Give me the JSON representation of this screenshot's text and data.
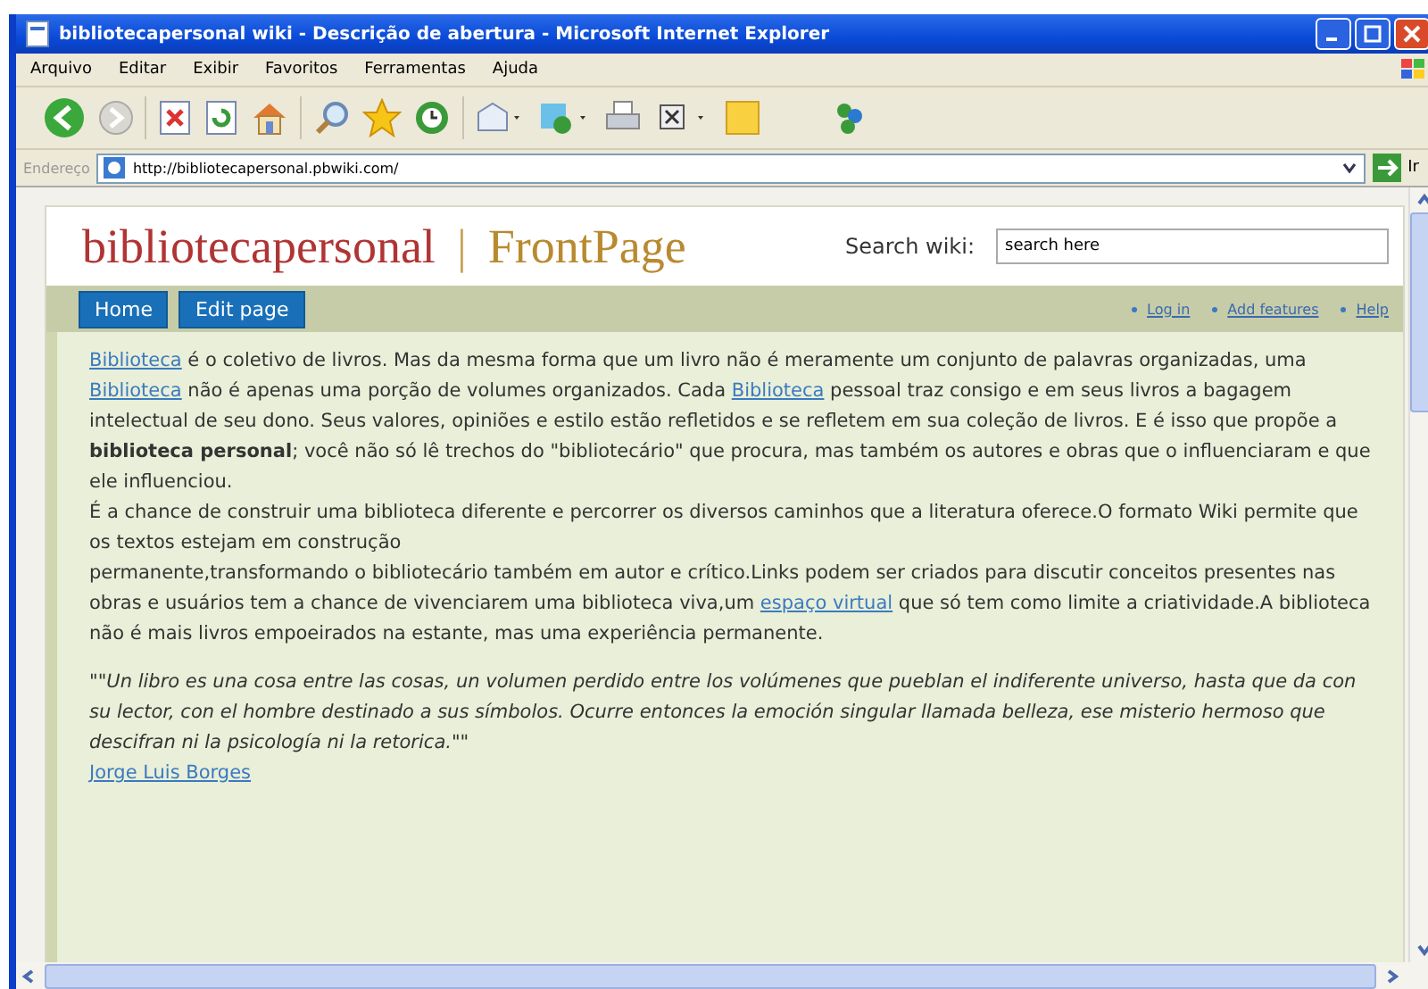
{
  "window": {
    "title": "bibliotecapersonal wiki - Descrição de abertura - Microsoft Internet Explorer"
  },
  "menu": [
    "Arquivo",
    "Editar",
    "Exibir",
    "Favoritos",
    "Ferramentas",
    "Ajuda"
  ],
  "address": {
    "label": "Endereço",
    "url": "http://bibliotecapersonal.pbwiki.com/",
    "go": "Ir"
  },
  "wiki": {
    "site_title": "bibliotecapersonal",
    "separator": "|",
    "page_title": "FrontPage",
    "search": {
      "label": "Search wiki:",
      "value": "search here"
    },
    "nav_buttons": [
      "Home",
      "Edit page"
    ],
    "nav_links": [
      "Log in",
      "Add features",
      "Help"
    ]
  },
  "paragraphs": [
    {
      "parts": [
        {
          "kind": "link",
          "text": "Biblioteca"
        },
        {
          "kind": "text",
          "text": " é o coletivo de livros. Mas da mesma forma que um livro não é meramente um conjunto de palavras organizadas, uma "
        },
        {
          "kind": "link",
          "text": "Biblioteca"
        },
        {
          "kind": "text",
          "text": " não é apenas uma porção de volumes organizados. Cada "
        },
        {
          "kind": "link",
          "text": "Biblioteca"
        },
        {
          "kind": "text",
          "text": " pessoal traz consigo e em seus livros a bagagem intelectual de seu dono. Seus valores, opiniões e estilo estão refletidos e se refletem em sua coleção de livros. E é isso que propõe a **biblioteca personal**; você não só lê trechos do \"bibliotecário\" que procura, mas também os autores e obras que o influenciaram e que ele influenciou."
        }
      ]
    },
    {
      "parts": [
        {
          "kind": "text",
          "text": "É a chance de construir uma biblioteca diferente e percorrer os diversos caminhos que a literatura oferece.O formato Wiki permite que os textos estejam em construção"
        }
      ]
    },
    {
      "parts": [
        {
          "kind": "text",
          "text": "permanente,transformando o bibliotecário também em autor e crítico.Links podem ser criados para discutir conceitos presentes nas obras e usuários tem a chance de vivenciarem uma biblioteca viva,um "
        },
        {
          "kind": "link",
          "text": "espaço virtual"
        },
        {
          "kind": "text",
          "text": " que só tem como limite a criatividade.A biblioteca não é mais livros empoeirados na estante, mas uma experiência permanente."
        }
      ]
    }
  ],
  "quote": {
    "text": "\"\"Un libro es una cosa entre las cosas, un volumen perdido entre los volúmenes que pueblan el indiferente universo, hasta que da con su lector, con el hombre destinado a sus símbolos. Ocurre entonces la emoción singular llamada belleza, ese misterio hermoso que descifran ni la psicología ni la retorica.\"\"",
    "author": "Jorge Luis Borges"
  }
}
